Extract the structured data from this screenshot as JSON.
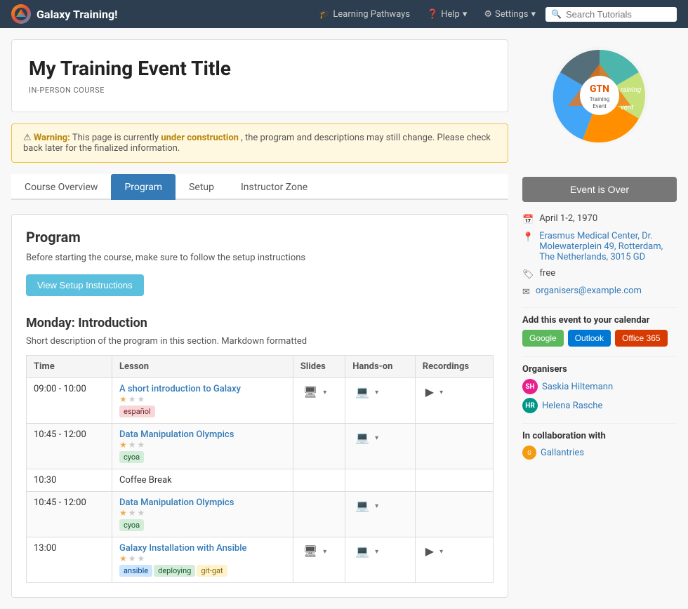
{
  "navbar": {
    "brand": "Galaxy Training!",
    "learning_pathways": "Learning Pathways",
    "help": "Help",
    "settings": "Settings",
    "search_placeholder": "Search Tutorials"
  },
  "event": {
    "title": "My Training Event Title",
    "badge": "IN-PERSON COURSE"
  },
  "warning": {
    "label": "Warning:",
    "text_before": "This page is currently",
    "bold_text": "under construction",
    "text_after": ", the program and descriptions may still change. Please check back later for the finalized information."
  },
  "tabs": [
    {
      "label": "Course Overview",
      "active": false
    },
    {
      "label": "Program",
      "active": true
    },
    {
      "label": "Setup",
      "active": false
    },
    {
      "label": "Instructor Zone",
      "active": false
    }
  ],
  "program": {
    "heading": "Program",
    "description": "Before starting the course, make sure to follow the setup instructions",
    "setup_btn": "View Setup Instructions",
    "day_heading": "Monday: Introduction",
    "day_description": "Short description of the program in this section. Markdown formatted",
    "table_headers": [
      "Time",
      "Lesson",
      "Slides",
      "Hands-on",
      "Recordings"
    ],
    "rows": [
      {
        "time": "09:00 - 10:00",
        "lesson": "A short introduction to Galaxy",
        "lesson_link": "#",
        "difficulty": "beginner",
        "stars": 1,
        "has_slides": true,
        "has_handson": true,
        "has_recordings": true,
        "tags": [
          {
            "label": "español",
            "class": "espanol"
          }
        ]
      },
      {
        "time": "10:45 - 12:00",
        "lesson": "Data Manipulation Olympics",
        "lesson_link": "#",
        "difficulty": "beginner",
        "stars": 1,
        "has_slides": false,
        "has_handson": true,
        "has_recordings": false,
        "tags": [
          {
            "label": "cyoa",
            "class": "cyoa"
          }
        ]
      },
      {
        "time": "10:30",
        "lesson": "Coffee Break",
        "lesson_link": null,
        "difficulty": null,
        "stars": 0,
        "has_slides": false,
        "has_handson": false,
        "has_recordings": false,
        "tags": []
      },
      {
        "time": "10:45 - 12:00",
        "lesson": "Data Manipulation Olympics",
        "lesson_link": "#",
        "difficulty": "beginner",
        "stars": 1,
        "has_slides": false,
        "has_handson": true,
        "has_recordings": false,
        "tags": [
          {
            "label": "cyoa",
            "class": "cyoa"
          }
        ]
      },
      {
        "time": "13:00",
        "lesson": "Galaxy Installation with Ansible",
        "lesson_link": "#",
        "difficulty": "beginner",
        "stars": 1,
        "has_slides": true,
        "has_handson": true,
        "has_recordings": true,
        "tags": [
          {
            "label": "ansible",
            "class": "ansible"
          },
          {
            "label": "deploying",
            "class": "deploying"
          },
          {
            "label": "git-gat",
            "class": "git-gat"
          }
        ]
      }
    ]
  },
  "sidebar": {
    "event_over": "Event is Over",
    "date": "April 1-2, 1970",
    "location": "Erasmus Medical Center, Dr. Molewaterplein 49, Rotterdam, The Netherlands, 3015 GD",
    "price": "free",
    "email": "organisers@example.com",
    "calendar_label": "Add this event to your calendar",
    "calendar_btns": [
      {
        "label": "Google",
        "class": ""
      },
      {
        "label": "Outlook",
        "class": "outlook"
      },
      {
        "label": "Office 365",
        "class": "office"
      }
    ],
    "organisers_label": "Organisers",
    "organisers": [
      {
        "name": "Saskia Hiltemann",
        "initials": "SH",
        "class": "pink"
      },
      {
        "name": "Helena Rasche",
        "initials": "HR",
        "class": "teal"
      }
    ],
    "collaboration_label": "In collaboration with",
    "collaborators": [
      {
        "name": "Gallantries"
      }
    ]
  }
}
